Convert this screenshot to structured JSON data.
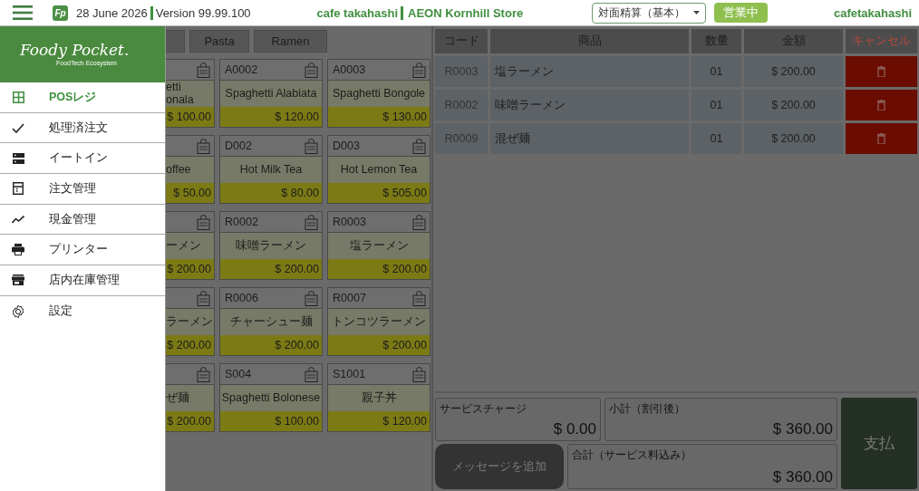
{
  "header": {
    "logo_text": "Fp",
    "date": "28 June 2026",
    "version": "Version 99.99.100",
    "shop": "cafe takahashi",
    "store": "AEON Kornhill Store",
    "mode_dropdown": "対面精算（基本）",
    "status_badge": "営業中",
    "user": "cafetakahashi"
  },
  "drawer": {
    "brand": "Foody Pocket.",
    "tagline": "FoodTech Ecosystem",
    "items": [
      {
        "label": "POSレジ",
        "selected": true
      },
      {
        "label": "処理済注文",
        "selected": false
      },
      {
        "label": "イートイン",
        "selected": false
      },
      {
        "label": "注文管理",
        "selected": false
      },
      {
        "label": "現金管理",
        "selected": false
      },
      {
        "label": "プリンター",
        "selected": false
      },
      {
        "label": "店内在庫管理",
        "selected": false
      },
      {
        "label": "設定",
        "selected": false
      }
    ]
  },
  "categories": [
    {
      "label": "Pasta",
      "selected": false
    },
    {
      "label": "Ramen",
      "selected": false
    }
  ],
  "products": [
    {
      "name": "etti\nonala",
      "price": "$ 100.00"
    },
    {
      "code": "A0002",
      "name": "Spaghetti Alabiata",
      "price": "$ 120.00"
    },
    {
      "code": "A0003",
      "name": "Spaghetti Bongole",
      "price": "$ 130.00"
    },
    {
      "name": "offee",
      "price": "$ 50.00"
    },
    {
      "code": "D002",
      "name": "Hot Milk Tea",
      "price": "$ 80.00"
    },
    {
      "code": "D003",
      "name": "Hot Lemon Tea",
      "price": "$ 505.00"
    },
    {
      "name": "ーメン",
      "price": "$ 200.00"
    },
    {
      "code": "R0002",
      "name": "味噌ラーメン",
      "price": "$ 200.00"
    },
    {
      "code": "R0003",
      "name": "塩ラーメン",
      "price": "$ 200.00"
    },
    {
      "name": "ラーメン",
      "price": "$ 200.00"
    },
    {
      "code": "R0006",
      "name": "チャーシュー麺",
      "price": "$ 200.00"
    },
    {
      "code": "R0007",
      "name": "トンコツラーメン",
      "price": "$ 200.00"
    },
    {
      "name": "ぜ麺",
      "price": "$ 200.00"
    },
    {
      "code": "S004",
      "name": "Spaghetti Bolonese",
      "price": "$ 100.00"
    },
    {
      "code": "S1001",
      "name": "親子丼",
      "price": "$ 120.00"
    }
  ],
  "order_table": {
    "columns": [
      "コード",
      "商品",
      "数量",
      "金額",
      "キャンセル"
    ],
    "rows": [
      {
        "code": "R0003",
        "product": "塩ラーメン",
        "quantity": "01",
        "amount": "$ 200.00"
      },
      {
        "code": "R0002",
        "product": "味噌ラーメン",
        "quantity": "01",
        "amount": "$ 200.00"
      },
      {
        "code": "R0009",
        "product": "混ぜ麺",
        "quantity": "01",
        "amount": "$ 200.00"
      }
    ]
  },
  "totals": {
    "service_charge": {
      "label": "サービスチャージ",
      "value": "$ 0.00"
    },
    "subtotal": {
      "label": "小計（割引後）",
      "value": "$ 360.00"
    },
    "total": {
      "label": "合計（サービス料込み）",
      "value": "$ 360.00"
    }
  },
  "add_message_button": "メッセージを追加",
  "pay_button": "支払"
}
